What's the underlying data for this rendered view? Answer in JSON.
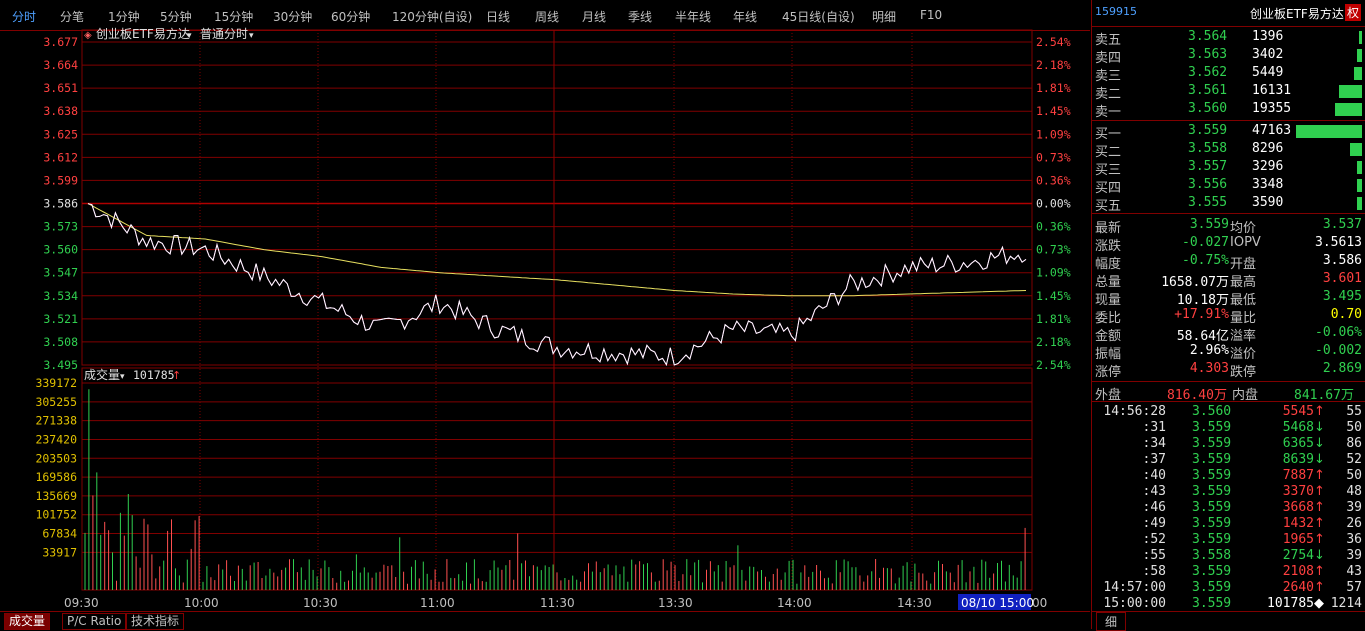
{
  "tabs": [
    {
      "label": "分时",
      "active": true
    },
    {
      "label": "分笔"
    },
    {
      "label": "1分钟"
    },
    {
      "label": "5分钟"
    },
    {
      "label": "15分钟"
    },
    {
      "label": "30分钟"
    },
    {
      "label": "60分钟"
    },
    {
      "label": "120分钟(自设)"
    },
    {
      "label": "日线"
    },
    {
      "label": "周线"
    },
    {
      "label": "月线"
    },
    {
      "label": "季线"
    },
    {
      "label": "半年线"
    },
    {
      "label": "年线"
    },
    {
      "label": "45日线(自设)"
    },
    {
      "label": "明细"
    },
    {
      "label": "F10"
    }
  ],
  "price_chart": {
    "instrument_menu": "创业板ETF易方达",
    "mode_menu": "普通分时",
    "price_ticks": [
      "3.677",
      "3.664",
      "3.651",
      "3.638",
      "3.625",
      "3.612",
      "3.599",
      "3.586",
      "3.573",
      "3.560",
      "3.547",
      "3.534",
      "3.521",
      "3.508",
      "3.495"
    ],
    "pct_ticks": [
      "2.54%",
      "2.18%",
      "1.81%",
      "1.45%",
      "1.09%",
      "0.73%",
      "0.36%",
      "0.00%",
      "0.36%",
      "0.73%",
      "1.09%",
      "1.45%",
      "1.81%",
      "2.18%",
      "2.54%"
    ],
    "prev_close": 3.586
  },
  "volume_chart": {
    "label": "成交量",
    "current_volume": "101785",
    "up_arrow": "↑",
    "ticks": [
      "339172",
      "305255",
      "271338",
      "237420",
      "203503",
      "169586",
      "135669",
      "101752",
      "67834",
      "33917"
    ]
  },
  "time_axis": [
    "09:30",
    "10:00",
    "10:30",
    "11:00",
    "11:30",
    "13:30",
    "14:00",
    "14:30"
  ],
  "time_cursor": "08/10 15:00",
  "time_end_fragment": "00",
  "bottom_tabs": [
    "成交量",
    "P/C Ratio",
    "技术指标"
  ],
  "right_panel": {
    "code": "159915",
    "name": "创业板ETF易方达",
    "badge": "权",
    "asks": [
      {
        "label": "卖五",
        "price": "3.564",
        "vol": "1396",
        "bar": 0.03
      },
      {
        "label": "卖四",
        "price": "3.563",
        "vol": "3402",
        "bar": 0.07
      },
      {
        "label": "卖三",
        "price": "3.562",
        "vol": "5449",
        "bar": 0.12
      },
      {
        "label": "卖二",
        "price": "3.561",
        "vol": "16131",
        "bar": 0.35
      },
      {
        "label": "卖一",
        "price": "3.560",
        "vol": "19355",
        "bar": 0.41
      }
    ],
    "bids": [
      {
        "label": "买一",
        "price": "3.559",
        "vol": "47163",
        "bar": 1.0
      },
      {
        "label": "买二",
        "price": "3.558",
        "vol": "8296",
        "bar": 0.18
      },
      {
        "label": "买三",
        "price": "3.557",
        "vol": "3296",
        "bar": 0.07
      },
      {
        "label": "买四",
        "price": "3.556",
        "vol": "3348",
        "bar": 0.07
      },
      {
        "label": "买五",
        "price": "3.555",
        "vol": "3590",
        "bar": 0.08
      }
    ],
    "quote": [
      {
        "l1": "最新",
        "v1": "3.559",
        "c1": "#30d050",
        "l2": "均价",
        "v2": "3.537",
        "c2": "#30d050"
      },
      {
        "l1": "涨跌",
        "v1": "-0.027",
        "c1": "#30d050",
        "l2": "IOPV",
        "v2": "3.5613",
        "c2": "#ffffff"
      },
      {
        "l1": "幅度",
        "v1": "-0.75%",
        "c1": "#30d050",
        "l2": "开盘",
        "v2": "3.586",
        "c2": "#ffffff"
      },
      {
        "l1": "总量",
        "v1": "1658.07万",
        "c1": "#ffffff",
        "l2": "最高",
        "v2": "3.601",
        "c2": "#ff4040"
      },
      {
        "l1": "现量",
        "v1": "10.18万",
        "c1": "#ffffff",
        "l2": "最低",
        "v2": "3.495",
        "c2": "#30d050"
      },
      {
        "l1": "委比",
        "v1": "+17.91%",
        "c1": "#ff4040",
        "l2": "量比",
        "v2": "0.70",
        "c2": "#ffff00"
      },
      {
        "l1": "金额",
        "v1": "58.64亿",
        "c1": "#ffffff",
        "l2": "溢率",
        "v2": "-0.06%",
        "c2": "#30d050"
      },
      {
        "l1": "振幅",
        "v1": "2.96%",
        "c1": "#ffffff",
        "l2": "溢价",
        "v2": "-0.002",
        "c2": "#30d050"
      },
      {
        "l1": "涨停",
        "v1": "4.303",
        "c1": "#ff4040",
        "l2": "跌停",
        "v2": "2.869",
        "c2": "#30d050"
      }
    ],
    "outer_label": "外盘",
    "outer_value": "816.40万",
    "inner_label": "内盘",
    "inner_value": "841.67万",
    "ticks": [
      {
        "t": "14:56:28",
        "p": "3.560",
        "pc": "#30d050",
        "v": "5545",
        "vc": "#ff4040",
        "a": "↑",
        "n": "55"
      },
      {
        "t": ":31",
        "p": "3.559",
        "pc": "#30d050",
        "v": "5468",
        "vc": "#30d050",
        "a": "↓",
        "n": "50"
      },
      {
        "t": ":34",
        "p": "3.559",
        "pc": "#30d050",
        "v": "6365",
        "vc": "#30d050",
        "a": "↓",
        "n": "86"
      },
      {
        "t": ":37",
        "p": "3.559",
        "pc": "#30d050",
        "v": "8639",
        "vc": "#30d050",
        "a": "↓",
        "n": "52"
      },
      {
        "t": ":40",
        "p": "3.559",
        "pc": "#30d050",
        "v": "7887",
        "vc": "#ff4040",
        "a": "↑",
        "n": "50"
      },
      {
        "t": ":43",
        "p": "3.559",
        "pc": "#30d050",
        "v": "3370",
        "vc": "#ff4040",
        "a": "↑",
        "n": "48"
      },
      {
        "t": ":46",
        "p": "3.559",
        "pc": "#30d050",
        "v": "3668",
        "vc": "#ff4040",
        "a": "↑",
        "n": "39"
      },
      {
        "t": ":49",
        "p": "3.559",
        "pc": "#30d050",
        "v": "1432",
        "vc": "#ff4040",
        "a": "↑",
        "n": "26"
      },
      {
        "t": ":52",
        "p": "3.559",
        "pc": "#30d050",
        "v": "1965",
        "vc": "#ff4040",
        "a": "↑",
        "n": "36"
      },
      {
        "t": ":55",
        "p": "3.558",
        "pc": "#30d050",
        "v": "2754",
        "vc": "#30d050",
        "a": "↓",
        "n": "39"
      },
      {
        "t": ":58",
        "p": "3.559",
        "pc": "#30d050",
        "v": "2108",
        "vc": "#ff4040",
        "a": "↑",
        "n": "43"
      },
      {
        "t": "14:57:00",
        "p": "3.559",
        "pc": "#30d050",
        "v": "2640",
        "vc": "#ff4040",
        "a": "↑",
        "n": "57"
      },
      {
        "t": "15:00:00",
        "p": "3.559",
        "pc": "#30d050",
        "v": "101785",
        "vc": "#ffffff",
        "a": "◆",
        "n": "1214"
      }
    ],
    "bottom_tab": "细"
  },
  "chart_data": {
    "type": "line",
    "title": "",
    "xlabel": "",
    "ylabel": "",
    "x": [
      "09:30",
      "09:45",
      "10:00",
      "10:15",
      "10:30",
      "10:45",
      "11:00",
      "11:15",
      "11:30",
      "13:15",
      "13:30",
      "13:45",
      "14:00",
      "14:15",
      "14:30",
      "14:45",
      "15:00"
    ],
    "series": [
      {
        "values": [
          3.586,
          3.565,
          3.56,
          3.545,
          3.53,
          3.515,
          3.53,
          3.515,
          3.505,
          3.502,
          3.5,
          3.515,
          3.512,
          3.54,
          3.55,
          3.553,
          3.559
        ]
      },
      {
        "values": [
          3.586,
          3.568,
          3.566,
          3.56,
          3.556,
          3.55,
          3.547,
          3.545,
          3.543,
          3.54,
          3.537,
          3.535,
          3.534,
          3.534,
          3.535,
          3.536,
          3.537
        ]
      }
    ],
    "ylim": [
      3.495,
      3.677
    ],
    "volume_ylim": [
      0,
      339172
    ],
    "grid": true
  }
}
